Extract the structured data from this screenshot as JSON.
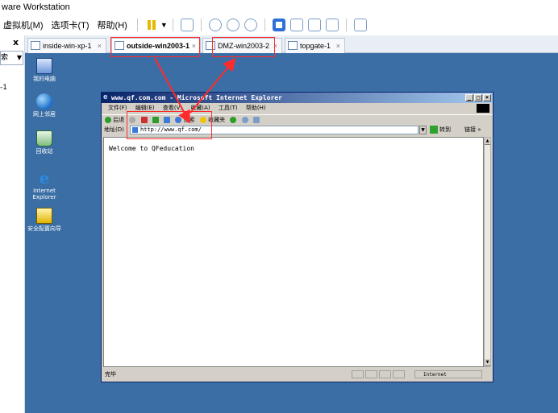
{
  "app": {
    "title": "ware Workstation"
  },
  "menubar": {
    "vm_menu": "虚拟机(M)",
    "tab_menu": "选项卡(T)",
    "help_menu": "帮助(H)"
  },
  "sidebar": {
    "close": "x",
    "search_text": "索",
    "tree_item": "-1"
  },
  "tabs": [
    {
      "label": "inside-win-xp-1",
      "close": "×"
    },
    {
      "label": "outside-win2003-1",
      "close": "×"
    },
    {
      "label": "DMZ-win2003-2",
      "close": "×"
    },
    {
      "label": "topgate-1",
      "close": "×"
    }
  ],
  "desktop_icons": [
    {
      "label": "我的电脑",
      "icon": "my-computer-icon"
    },
    {
      "label": "网上邻居",
      "icon": "network-places-icon"
    },
    {
      "label": "回收站",
      "icon": "recycle-bin-icon"
    },
    {
      "label": "Internet Explorer",
      "icon": "internet-explorer-icon"
    },
    {
      "label": "安全配置向导",
      "icon": "security-wizard-icon"
    }
  ],
  "ie": {
    "title": "www.qf.com.com - Microsoft Internet Explorer",
    "menu": [
      "文件(F)",
      "编辑(E)",
      "查看(V)",
      "收藏(A)",
      "工具(T)",
      "帮助(H)"
    ],
    "toolbar": {
      "back": "后退",
      "search": "搜索",
      "favorites": "收藏夹"
    },
    "address_label": "地址(D)",
    "address_value": "http://www.qf.com/",
    "go_label": "转到",
    "links_label": "链接 »",
    "content_text": "Welcome to QFeducation",
    "status_text": "完毕",
    "zone_text": "Internet"
  },
  "annotation_color": "#ff2b2b"
}
